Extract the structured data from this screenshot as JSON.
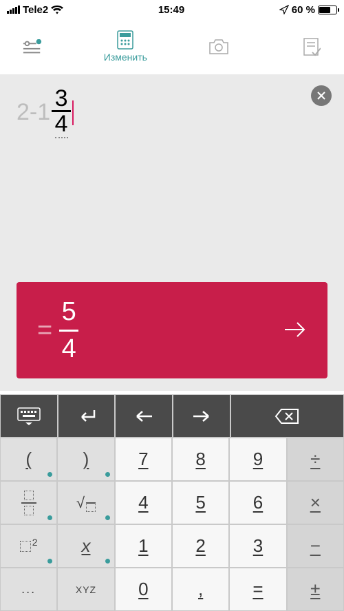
{
  "status": {
    "carrier": "Tele2",
    "time": "15:49",
    "battery_pct": "60 %"
  },
  "toolbar": {
    "edit_label": "Изменить"
  },
  "input": {
    "prefix": "2-1",
    "numerator": "3",
    "denominator": "4"
  },
  "result": {
    "equals": "=",
    "numerator": "5",
    "denominator": "4"
  },
  "keys": {
    "lparen": "(",
    "rparen": ")",
    "n7": "7",
    "n8": "8",
    "n9": "9",
    "div": "÷",
    "n4": "4",
    "n5": "5",
    "n6": "6",
    "mul": "×",
    "sq": "2",
    "xvar": "x",
    "n1": "1",
    "n2": "2",
    "n3": "3",
    "sub": "−",
    "ellipsis": "...",
    "xyz": "XYZ",
    "n0": "0",
    "comma": ",",
    "eq": "=",
    "pm": "±",
    "sqrt": "√"
  }
}
